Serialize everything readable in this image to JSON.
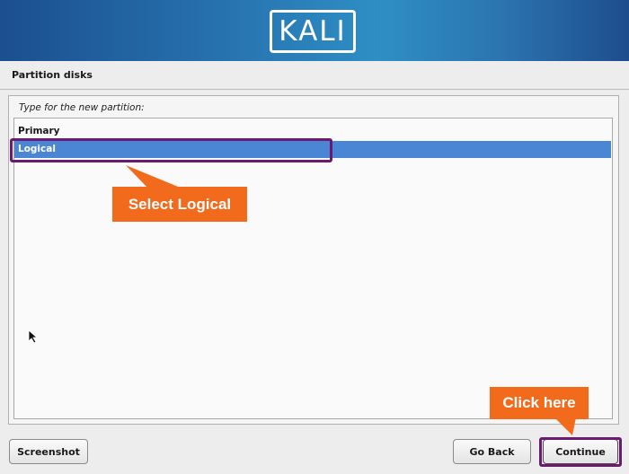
{
  "banner": {
    "logo_text": "KALI"
  },
  "page": {
    "title": "Partition disks"
  },
  "prompt": {
    "question": "Type for the new partition:"
  },
  "options": [
    {
      "label": "Primary",
      "selected": false
    },
    {
      "label": "Logical",
      "selected": true
    }
  ],
  "annotations": {
    "select_callout": "Select Logical",
    "click_callout": "Click here"
  },
  "buttons": {
    "screenshot": "Screenshot",
    "go_back": "Go Back",
    "continue": "Continue"
  },
  "colors": {
    "banner": "#2877b3",
    "selection": "#4a86d4",
    "callout": "#f26a1b",
    "highlight_border": "#6a1a6f"
  }
}
